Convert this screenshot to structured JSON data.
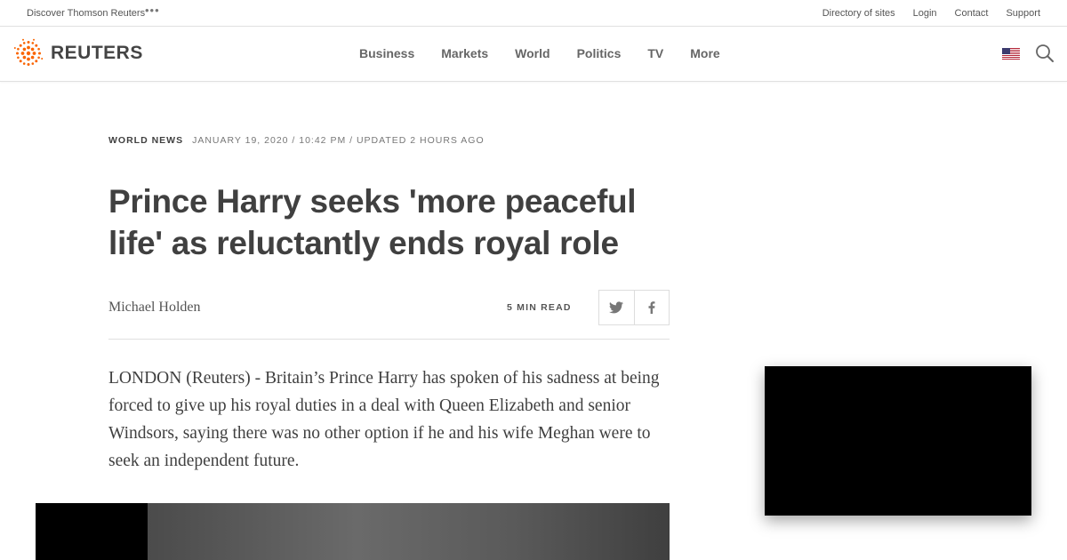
{
  "utility": {
    "discover": "Discover Thomson Reuters",
    "more_glyph": "•••",
    "links": [
      "Directory of sites",
      "Login",
      "Contact",
      "Support"
    ]
  },
  "header": {
    "logo_text": "REUTERS",
    "logo_color": "#fa6400",
    "nav": [
      "Business",
      "Markets",
      "World",
      "Politics",
      "TV",
      "More"
    ],
    "flag_icon": "us-flag-icon",
    "search_icon": "search-icon"
  },
  "article": {
    "section": "WORLD NEWS",
    "date": "JANUARY 19, 2020 / 10:42 PM / UPDATED 2 HOURS AGO",
    "headline": "Prince Harry seeks 'more peaceful life' as reluctantly ends royal role",
    "author": "Michael Holden",
    "read_time": "5 MIN READ",
    "share_icons": [
      "twitter-icon",
      "facebook-icon"
    ],
    "lede": "LONDON (Reuters) - Britain’s Prince Harry has spoken of his sadness at being forced to give up his royal duties in a deal with Queen Elizabeth and senior Windsors, saying there was no other option if he and his wife Meghan were to seek an independent future."
  }
}
